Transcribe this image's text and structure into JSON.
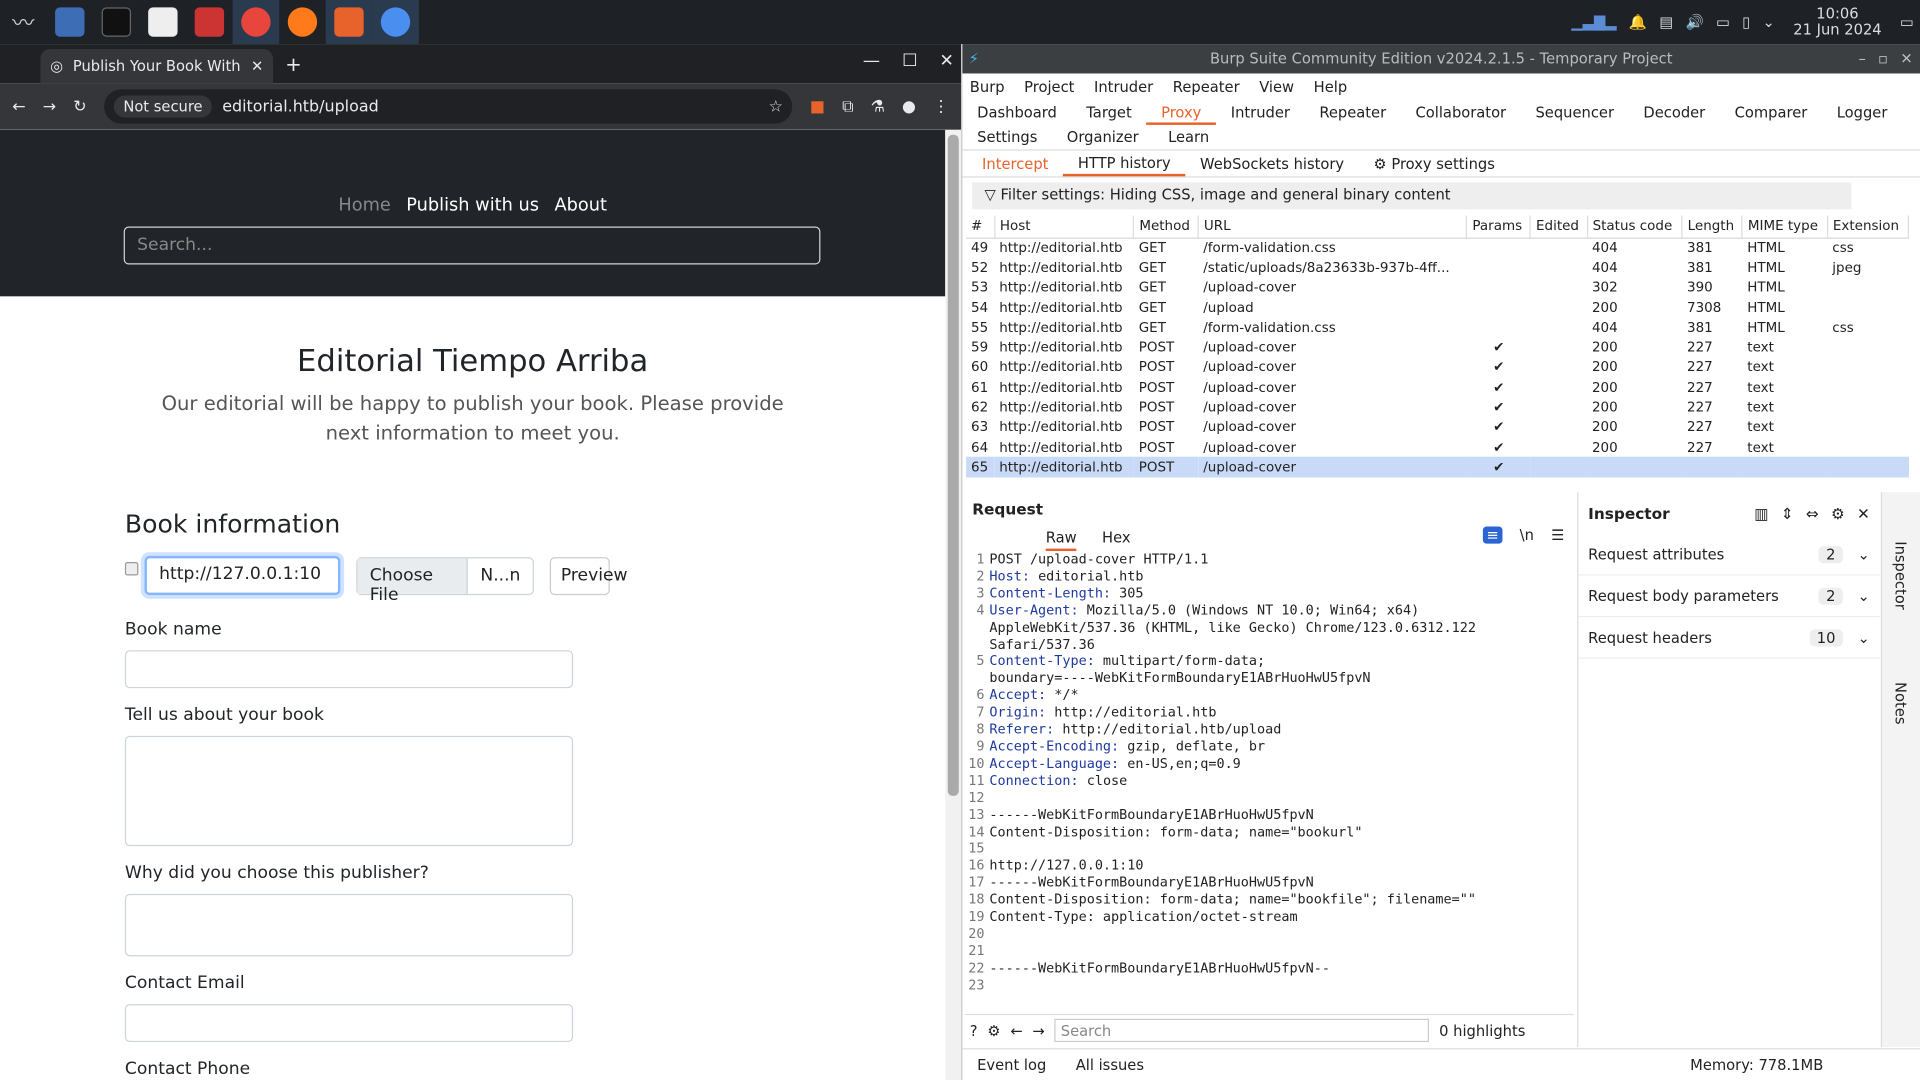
{
  "taskbar": {
    "time": "10:06",
    "date": "21 Jun 2024"
  },
  "chrome": {
    "tab_title": "Publish Your Book With Us",
    "not_secure": "Not secure",
    "url": "editorial.htb/upload"
  },
  "site": {
    "nav": [
      "Home",
      "Publish with us",
      "About"
    ],
    "search_placeholder": "Search...",
    "title": "Editorial Tiempo Arriba",
    "lead": "Our editorial will be happy to publish your book. Please provide next information to meet you.",
    "section": "Book information",
    "url_value": "http://127.0.0.1:10",
    "choose_file": "Choose File",
    "file_name": "N...n",
    "preview": "Preview",
    "labels": [
      "Book name",
      "Tell us about your book",
      "Why did you choose this publisher?",
      "Contact Email",
      "Contact Phone"
    ]
  },
  "burp": {
    "title": "Burp Suite Community Edition v2024.2.1.5 - Temporary Project",
    "menu": [
      "Burp",
      "Project",
      "Intruder",
      "Repeater",
      "View",
      "Help"
    ],
    "tabs": [
      "Dashboard",
      "Target",
      "Proxy",
      "Intruder",
      "Repeater",
      "Collaborator",
      "Sequencer",
      "Decoder",
      "Comparer",
      "Logger",
      "Settings",
      "Organizer",
      "Learn"
    ],
    "subtabs": [
      "Intercept",
      "HTTP history",
      "WebSockets history",
      "Proxy settings"
    ],
    "filter": "Filter settings: Hiding CSS, image and general binary content",
    "columns": [
      "#",
      "Host",
      "Method",
      "URL",
      "Params",
      "Edited",
      "Status code",
      "Length",
      "MIME type",
      "Extension"
    ],
    "rows": [
      [
        "49",
        "http://editorial.htb",
        "GET",
        "/form-validation.css",
        "",
        "",
        "404",
        "381",
        "HTML",
        "css"
      ],
      [
        "52",
        "http://editorial.htb",
        "GET",
        "/static/uploads/8a23633b-937b-4ff...",
        "",
        "",
        "404",
        "381",
        "HTML",
        "jpeg"
      ],
      [
        "53",
        "http://editorial.htb",
        "GET",
        "/upload-cover",
        "",
        "",
        "302",
        "390",
        "HTML",
        ""
      ],
      [
        "54",
        "http://editorial.htb",
        "GET",
        "/upload",
        "",
        "",
        "200",
        "7308",
        "HTML",
        ""
      ],
      [
        "55",
        "http://editorial.htb",
        "GET",
        "/form-validation.css",
        "",
        "",
        "404",
        "381",
        "HTML",
        "css"
      ],
      [
        "59",
        "http://editorial.htb",
        "POST",
        "/upload-cover",
        "✔",
        "",
        "200",
        "227",
        "text",
        ""
      ],
      [
        "60",
        "http://editorial.htb",
        "POST",
        "/upload-cover",
        "✔",
        "",
        "200",
        "227",
        "text",
        ""
      ],
      [
        "61",
        "http://editorial.htb",
        "POST",
        "/upload-cover",
        "✔",
        "",
        "200",
        "227",
        "text",
        ""
      ],
      [
        "62",
        "http://editorial.htb",
        "POST",
        "/upload-cover",
        "✔",
        "",
        "200",
        "227",
        "text",
        ""
      ],
      [
        "63",
        "http://editorial.htb",
        "POST",
        "/upload-cover",
        "✔",
        "",
        "200",
        "227",
        "text",
        ""
      ],
      [
        "64",
        "http://editorial.htb",
        "POST",
        "/upload-cover",
        "✔",
        "",
        "200",
        "227",
        "text",
        ""
      ],
      [
        "65",
        "http://editorial.htb",
        "POST",
        "/upload-cover",
        "✔",
        "",
        "",
        "",
        "",
        ""
      ]
    ],
    "request_title": "Request",
    "raw": "Raw",
    "hex": "Hex",
    "request_lines": [
      [
        "",
        "POST /upload-cover HTTP/1.1"
      ],
      [
        "Host:",
        " editorial.htb"
      ],
      [
        "Content-Length:",
        " 305"
      ],
      [
        "User-Agent:",
        " Mozilla/5.0 (Windows NT 10.0; Win64; x64)"
      ],
      [
        "",
        "AppleWebKit/537.36 (KHTML, like Gecko) Chrome/123.0.6312.122"
      ],
      [
        "",
        "Safari/537.36"
      ],
      [
        "Content-Type:",
        " multipart/form-data;"
      ],
      [
        "",
        "boundary=----WebKitFormBoundaryE1ABrHuoHwU5fpvN"
      ],
      [
        "Accept:",
        " */*"
      ],
      [
        "Origin:",
        " http://editorial.htb"
      ],
      [
        "Referer:",
        " http://editorial.htb/upload"
      ],
      [
        "Accept-Encoding:",
        " gzip, deflate, br"
      ],
      [
        "Accept-Language:",
        " en-US,en;q=0.9"
      ],
      [
        "Connection:",
        " close"
      ],
      [
        "",
        ""
      ],
      [
        "",
        "------WebKitFormBoundaryE1ABrHuoHwU5fpvN"
      ],
      [
        "",
        "Content-Disposition: form-data; name=\"bookurl\""
      ],
      [
        "",
        ""
      ],
      [
        "",
        "http://127.0.0.1:10"
      ],
      [
        "",
        "------WebKitFormBoundaryE1ABrHuoHwU5fpvN"
      ],
      [
        "",
        "Content-Disposition: form-data; name=\"bookfile\"; filename=\"\""
      ],
      [
        "",
        "Content-Type: application/octet-stream"
      ],
      [
        "",
        ""
      ],
      [
        "",
        ""
      ],
      [
        "",
        "------WebKitFormBoundaryE1ABrHuoHwU5fpvN--"
      ],
      [
        "",
        ""
      ]
    ],
    "line_numbers": [
      "1",
      "2",
      "3",
      "4",
      "",
      "",
      "5",
      "",
      "6",
      "7",
      "8",
      "9",
      "10",
      "11",
      "12",
      "13",
      "14",
      "15",
      "16",
      "17",
      "18",
      "19",
      "20",
      "21",
      "22",
      "23"
    ],
    "inspector": "Inspector",
    "insp_rows": [
      [
        "Request attributes",
        "2"
      ],
      [
        "Request body parameters",
        "2"
      ],
      [
        "Request headers",
        "10"
      ]
    ],
    "side": [
      "Inspector",
      "Notes"
    ],
    "search_ph": "Search",
    "highlights": "0 highlights",
    "event_log": "Event log",
    "all_issues": "All issues",
    "memory": "Memory: 778.1MB"
  }
}
